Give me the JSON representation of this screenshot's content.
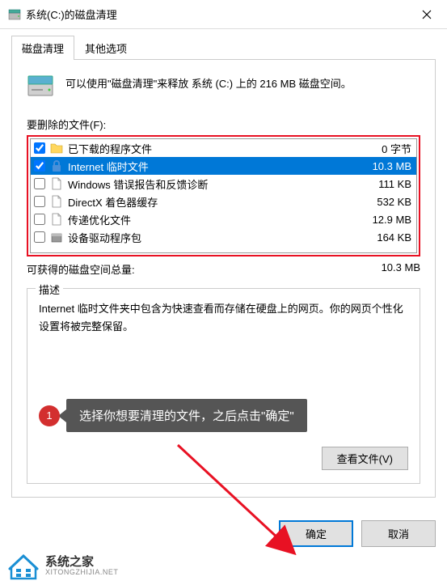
{
  "titlebar": {
    "title": "系统(C:)的磁盘清理"
  },
  "tabs": {
    "cleanup": "磁盘清理",
    "other": "其他选项"
  },
  "info": "可以使用\"磁盘清理\"来释放 系统 (C:) 上的 216 MB 磁盘空间。",
  "section_label": "要删除的文件(F):",
  "files": [
    {
      "checked": true,
      "icon": "folder",
      "name": "已下载的程序文件",
      "size": "0 字节",
      "selected": false
    },
    {
      "checked": true,
      "icon": "lock",
      "name": "Internet 临时文件",
      "size": "10.3 MB",
      "selected": true
    },
    {
      "checked": false,
      "icon": "file",
      "name": "Windows 错误报告和反馈诊断",
      "size": "111 KB",
      "selected": false
    },
    {
      "checked": false,
      "icon": "file",
      "name": "DirectX 着色器缓存",
      "size": "532 KB",
      "selected": false
    },
    {
      "checked": false,
      "icon": "file",
      "name": "传递优化文件",
      "size": "12.9 MB",
      "selected": false
    },
    {
      "checked": false,
      "icon": "package",
      "name": "设备驱动程序包",
      "size": "164 KB",
      "selected": false
    }
  ],
  "total": {
    "label": "可获得的磁盘空间总量:",
    "value": "10.3 MB"
  },
  "description": {
    "legend": "描述",
    "text": "Internet 临时文件夹中包含为快速查看而存储在硬盘上的网页。你的网页个性化设置将被完整保留。"
  },
  "callout": {
    "badge": "1",
    "text": "选择你想要清理的文件，之后点击\"确定\""
  },
  "buttons": {
    "viewfiles": "查看文件(V)",
    "ok": "确定",
    "cancel": "取消"
  },
  "watermark": {
    "cn": "系统之家",
    "en": "XITONGZHIJIA.NET"
  }
}
